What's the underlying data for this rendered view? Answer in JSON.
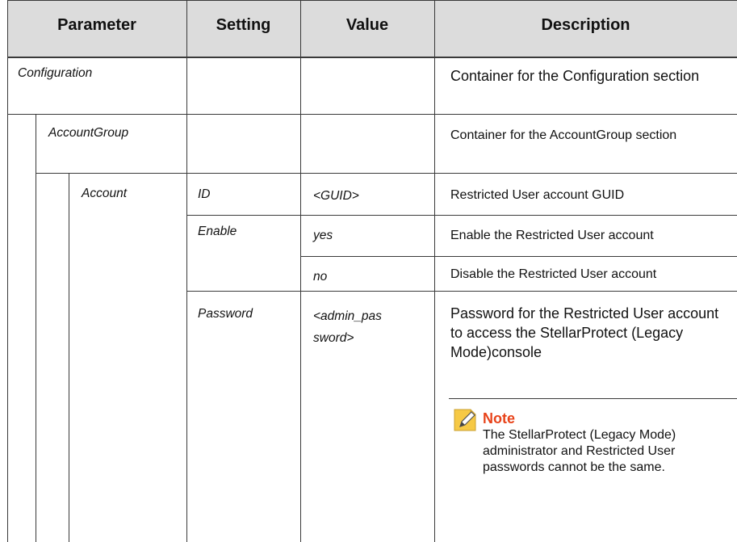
{
  "header": {
    "parameter": "Parameter",
    "setting": "Setting",
    "value": "Value",
    "description": "Description"
  },
  "rows": {
    "configuration": {
      "parameter": "Configuration",
      "description": "Container for the Configuration section"
    },
    "account_group": {
      "parameter": "AccountGroup",
      "description": "Container for the AccountGroup section"
    },
    "account": {
      "parameter": "Account",
      "id_setting": "ID",
      "id_value": "<GUID>",
      "id_description": "Restricted User account GUID",
      "enable_setting": "Enable",
      "enable_yes_value": "yes",
      "enable_yes_description": "Enable the Restricted User account",
      "enable_no_value": "no",
      "enable_no_description": "Disable the Restricted User account",
      "password_setting": "Password",
      "password_value_line1": "<admin_pas",
      "password_value_line2": "sword>",
      "password_description": "Password for the Restricted User account to access the StellarProtect (Legacy Mode)console"
    }
  },
  "note": {
    "icon": "note-pencil-icon",
    "title": "Note",
    "text": "The StellarProtect (Legacy Mode) administrator and Restricted User passwords cannot be the same."
  },
  "colors": {
    "header_bg": "#dcdcdc",
    "note_title": "#e8431a",
    "note_icon": "#f6c945"
  }
}
